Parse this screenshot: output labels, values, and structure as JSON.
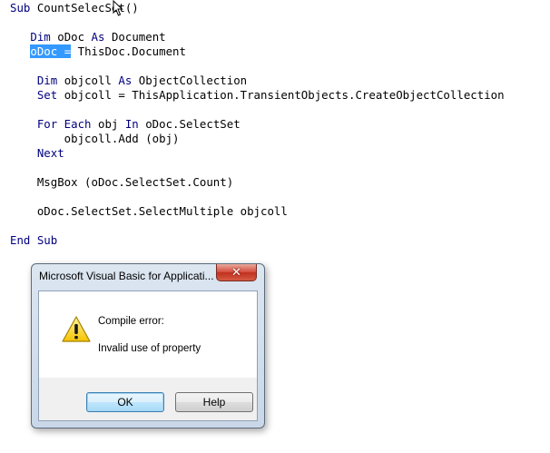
{
  "code": {
    "lines": [
      {
        "parts": [
          {
            "t": "Sub ",
            "c": "kw"
          },
          {
            "t": "CountSelec",
            "c": ""
          },
          {
            "t": "Set()",
            "c": ""
          }
        ]
      },
      {
        "parts": []
      },
      {
        "parts": [
          {
            "t": "   ",
            "c": ""
          },
          {
            "t": "Dim ",
            "c": "kw"
          },
          {
            "t": "oDoc ",
            "c": ""
          },
          {
            "t": "As ",
            "c": "kw"
          },
          {
            "t": "Document",
            "c": ""
          }
        ]
      },
      {
        "parts": [
          {
            "t": "   ",
            "c": ""
          },
          {
            "t": "oDoc =",
            "c": "sel"
          },
          {
            "t": " ThisDoc.Document",
            "c": ""
          }
        ]
      },
      {
        "parts": []
      },
      {
        "parts": [
          {
            "t": "    ",
            "c": ""
          },
          {
            "t": "Dim ",
            "c": "kw"
          },
          {
            "t": "objcoll ",
            "c": ""
          },
          {
            "t": "As ",
            "c": "kw"
          },
          {
            "t": "ObjectCollection",
            "c": ""
          }
        ]
      },
      {
        "parts": [
          {
            "t": "    ",
            "c": ""
          },
          {
            "t": "Set ",
            "c": "kw"
          },
          {
            "t": "objcoll = ThisApplication.TransientObjects.CreateObjectCollection",
            "c": ""
          }
        ]
      },
      {
        "parts": []
      },
      {
        "parts": [
          {
            "t": "    ",
            "c": ""
          },
          {
            "t": "For Each ",
            "c": "kw"
          },
          {
            "t": "obj ",
            "c": ""
          },
          {
            "t": "In ",
            "c": "kw"
          },
          {
            "t": "oDoc.SelectSet",
            "c": ""
          }
        ]
      },
      {
        "parts": [
          {
            "t": "        objcoll.Add (obj)",
            "c": ""
          }
        ]
      },
      {
        "parts": [
          {
            "t": "    ",
            "c": ""
          },
          {
            "t": "Next",
            "c": "kw"
          }
        ]
      },
      {
        "parts": []
      },
      {
        "parts": [
          {
            "t": "    MsgBox (oDoc.SelectSet.Count)",
            "c": ""
          }
        ]
      },
      {
        "parts": []
      },
      {
        "parts": [
          {
            "t": "    oDoc.SelectSet.SelectMultiple objcoll",
            "c": ""
          }
        ]
      },
      {
        "parts": []
      },
      {
        "parts": [
          {
            "t": "End Sub",
            "c": "kw"
          }
        ]
      }
    ]
  },
  "dialog": {
    "title": "Microsoft Visual Basic for Applicati...",
    "message_line1": "Compile error:",
    "message_line2": "Invalid use of property",
    "ok_label": "OK",
    "help_label": "Help",
    "close_glyph": "✕",
    "icon": "warning-icon"
  },
  "colors": {
    "keyword": "#00007f",
    "selection": "#3399ff",
    "close_button": "#c0301f"
  }
}
